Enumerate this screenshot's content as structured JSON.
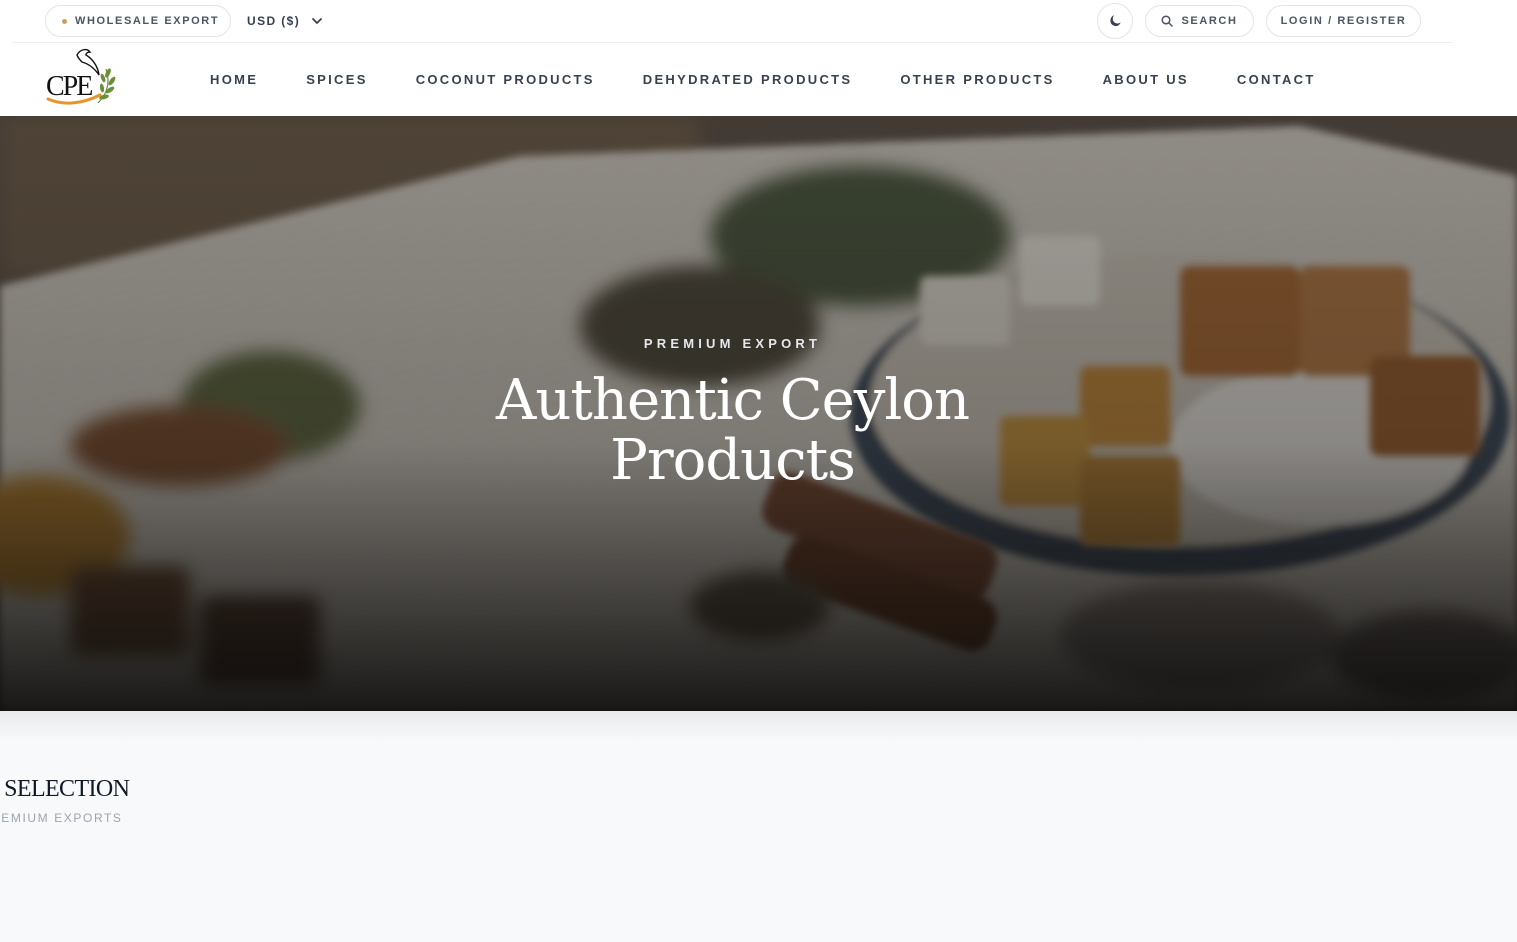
{
  "topbar": {
    "wholesale_label": "WHOLESALE EXPORT",
    "currency_label": "USD ($)",
    "theme_icon": "moon-icon",
    "search_label": "SEARCH",
    "login_label": "LOGIN / REGISTER"
  },
  "brand": {
    "logo_text": "CPE",
    "accent_color": "#c9a15b"
  },
  "nav": {
    "items": [
      {
        "label": "HOME"
      },
      {
        "label": "SPICES"
      },
      {
        "label": "COCONUT PRODUCTS"
      },
      {
        "label": "DEHYDRATED PRODUCTS"
      },
      {
        "label": "OTHER PRODUCTS"
      },
      {
        "label": "ABOUT US"
      },
      {
        "label": "CONTACT"
      }
    ]
  },
  "hero": {
    "kicker": "PREMIUM EXPORT",
    "title_line1": "Authentic Ceylon",
    "title_line2": "Products"
  },
  "section": {
    "title": "D SELECTION",
    "subtitle": "REMIUM EXPORTS"
  }
}
